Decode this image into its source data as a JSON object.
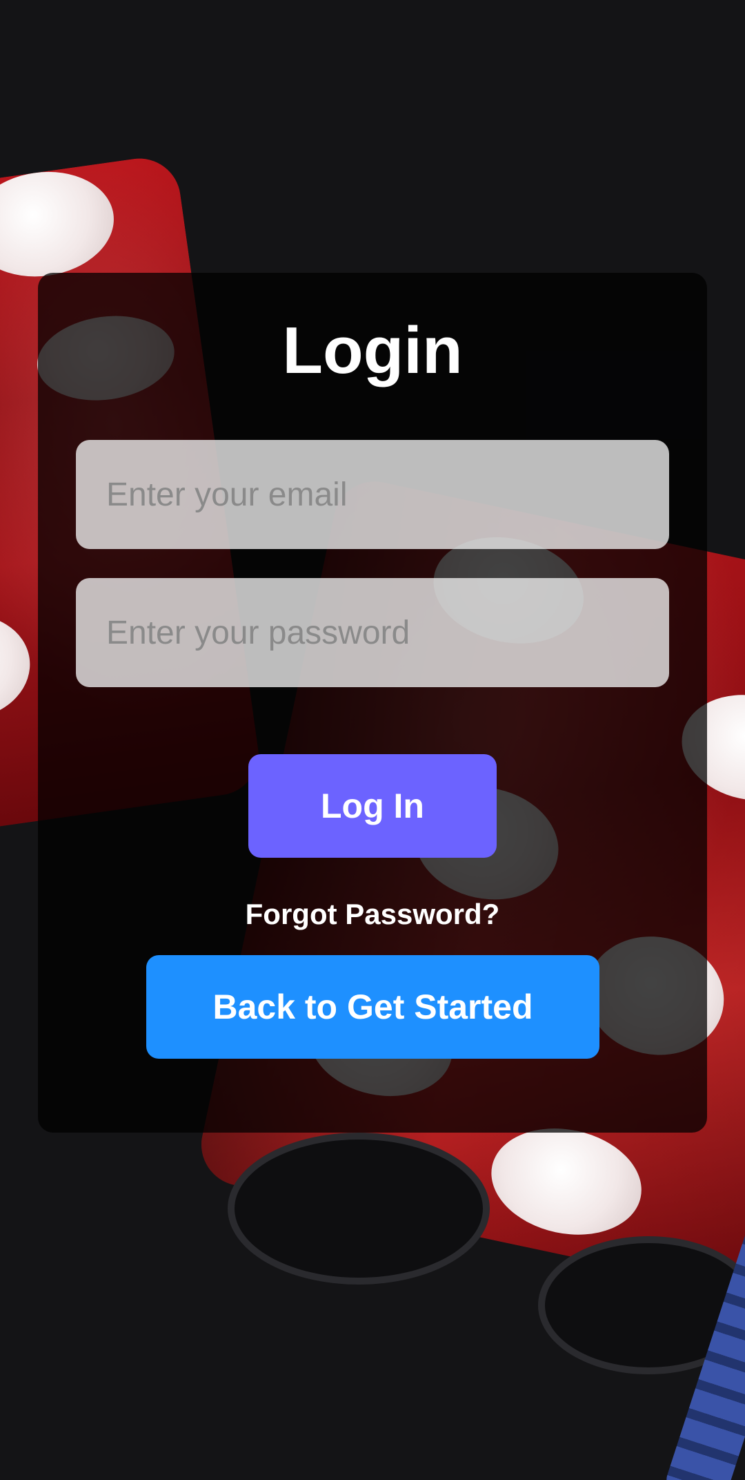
{
  "login": {
    "title": "Login",
    "email_placeholder": "Enter your email",
    "password_placeholder": "Enter your password",
    "login_button": "Log In",
    "forgot_password": "Forgot Password?",
    "back_button": "Back to Get Started"
  },
  "colors": {
    "login_button": "#6c63ff",
    "back_button": "#1e90ff",
    "card_background": "rgba(0,0,0,0.74)",
    "page_background": "#141416"
  },
  "background": {
    "image_subject": "red dice and casino chips"
  }
}
